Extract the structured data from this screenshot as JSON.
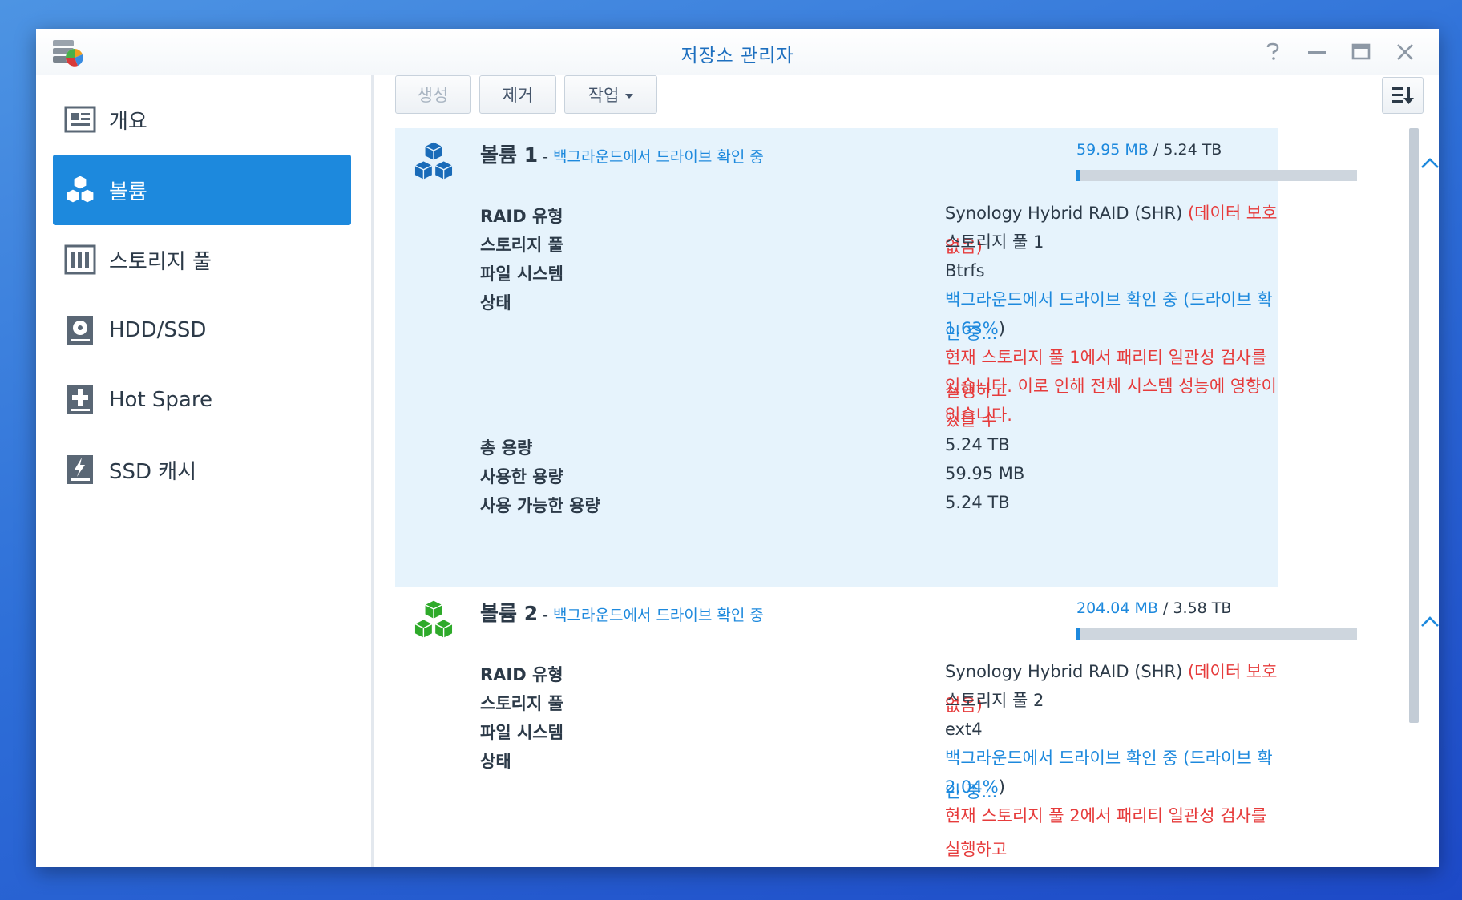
{
  "window": {
    "title": "저장소 관리자"
  },
  "sidebar": {
    "items": [
      {
        "label": "개요",
        "icon": "overview-icon",
        "active": false
      },
      {
        "label": "볼륨",
        "icon": "volume-icon",
        "active": true
      },
      {
        "label": "스토리지 풀",
        "icon": "storage-pool-icon",
        "active": false
      },
      {
        "label": "HDD/SSD",
        "icon": "hdd-icon",
        "active": false
      },
      {
        "label": "Hot Spare",
        "icon": "hot-spare-icon",
        "active": false
      },
      {
        "label": "SSD 캐시",
        "icon": "ssd-cache-icon",
        "active": false
      }
    ]
  },
  "toolbar": {
    "create_label": "생성",
    "remove_label": "제거",
    "action_label": "작업"
  },
  "labels": {
    "raid_type": "RAID 유형",
    "storage_pool": "스토리지 풀",
    "file_system": "파일 시스템",
    "status": "상태",
    "total_capacity": "총 용량",
    "used_capacity": "사용한 용량",
    "available_capacity": "사용 가능한 용량"
  },
  "volumes": [
    {
      "name": "볼륨 1",
      "dash": " - ",
      "header_status": "백그라운드에서 드라이브 확인 중",
      "used": "59.95 MB",
      "sep": " / ",
      "total": "5.24 TB",
      "usage_fraction": 0.01,
      "icon_color": "#1a6bb8",
      "raid_type": "Synology Hybrid RAID (SHR)",
      "raid_note": "(데이터 보호 없음)",
      "storage_pool": "스토리지 풀 1",
      "file_system": "Btrfs",
      "status_line1": "백그라운드에서 드라이브 확인 중 (드라이브 확인 중...",
      "status_line2": "1.63%",
      "status_close": ")",
      "warning_lines": [
        "현재 스토리지 풀 1에서 패리티 일관성 검사를 실행하고",
        "있습니다. 이로 인해 전체 시스템 성능에 영향이 있을 수",
        "있습니다."
      ],
      "total_capacity": "5.24 TB",
      "used_capacity": "59.95 MB",
      "available_capacity": "5.24 TB"
    },
    {
      "name": "볼륨 2",
      "dash": " - ",
      "header_status": "백그라운드에서 드라이브 확인 중",
      "used": "204.04 MB",
      "sep": " / ",
      "total": "3.58 TB",
      "usage_fraction": 0.01,
      "icon_color": "#2eaa2a",
      "raid_type": "Synology Hybrid RAID (SHR)",
      "raid_note": "(데이터 보호 없음)",
      "storage_pool": "스토리지 풀 2",
      "file_system": "ext4",
      "status_line1": "백그라운드에서 드라이브 확인 중 (드라이브 확인 중...",
      "status_line2": "2.04%",
      "status_close": ")",
      "warning_lines": [
        "현재 스토리지 풀 2에서 패리티 일관성 검사를 실행하고"
      ]
    }
  ]
}
